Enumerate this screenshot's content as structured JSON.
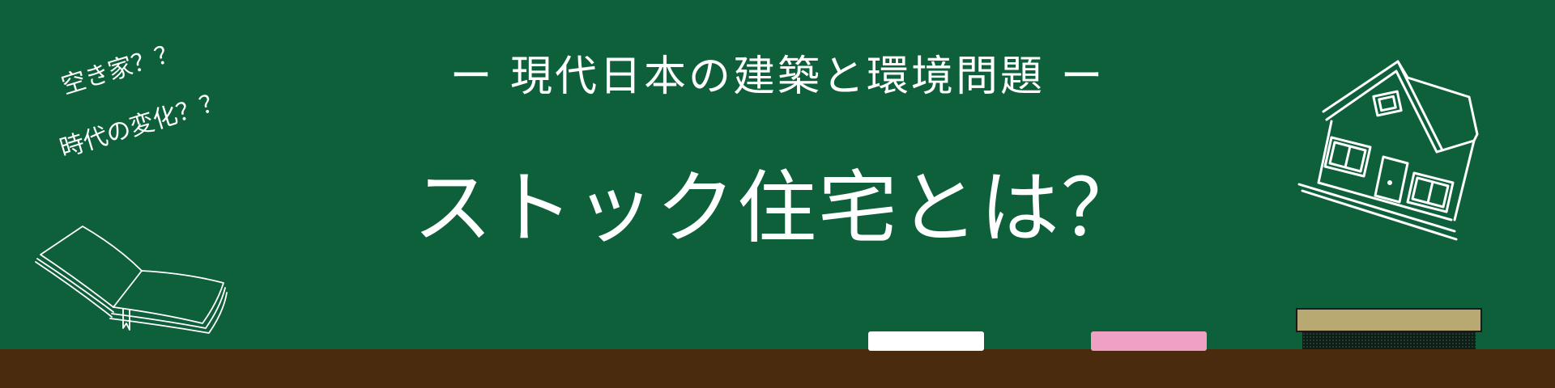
{
  "header": {
    "subtitle": "ー 現代日本の建築と環境問題 ー",
    "title": "ストック住宅とは？"
  },
  "notes": {
    "line1": "空き家？？",
    "line2": "時代の変化？？"
  },
  "icons": {
    "book": "open-book-icon",
    "house": "house-icon"
  },
  "colors": {
    "board": "#0d603a",
    "ledge": "#4b2b0e",
    "chalk_white": "#ffffff",
    "chalk_pink": "#f0a0c3",
    "eraser": "#b8a872"
  }
}
